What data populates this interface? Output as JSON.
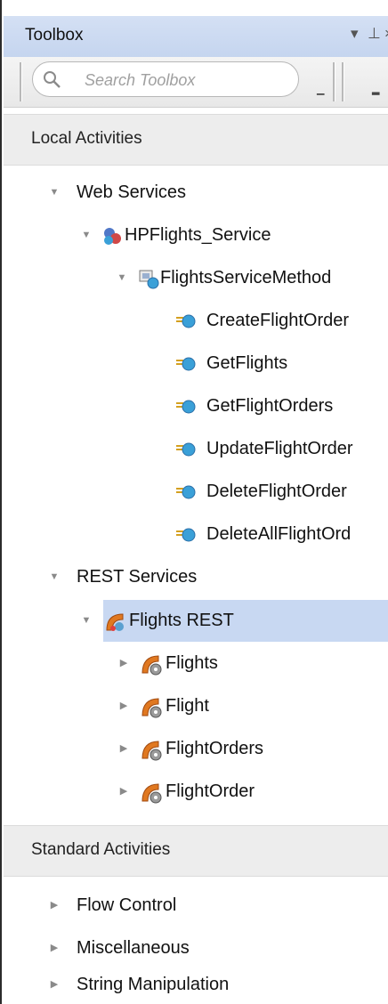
{
  "panel": {
    "title": "Toolbox",
    "controls": {
      "dropdown": "▾",
      "pin": "⊥",
      "close": "×"
    }
  },
  "search": {
    "placeholder": "Search Toolbox"
  },
  "sections": {
    "local": "Local Activities",
    "standard": "Standard Activities"
  },
  "tree": {
    "web_services": "Web Services",
    "hpflights_service": "HPFlights_Service",
    "flights_service_method": "FlightsServiceMethod",
    "methods": [
      "CreateFlightOrder",
      "GetFlights",
      "GetFlightOrders",
      "UpdateFlightOrder",
      "DeleteFlightOrder",
      "DeleteAllFlightOrd"
    ],
    "rest_services": "REST Services",
    "flights_rest": "Flights REST",
    "resources": [
      "Flights",
      "Flight",
      "FlightOrders",
      "FlightOrder"
    ],
    "standard_items": [
      "Flow Control",
      "Miscellaneous",
      "String Manipulation"
    ]
  },
  "colors": {
    "titlebar": "#c5d5ef",
    "selection": "#c8d8f2",
    "section_header": "#ededed"
  }
}
